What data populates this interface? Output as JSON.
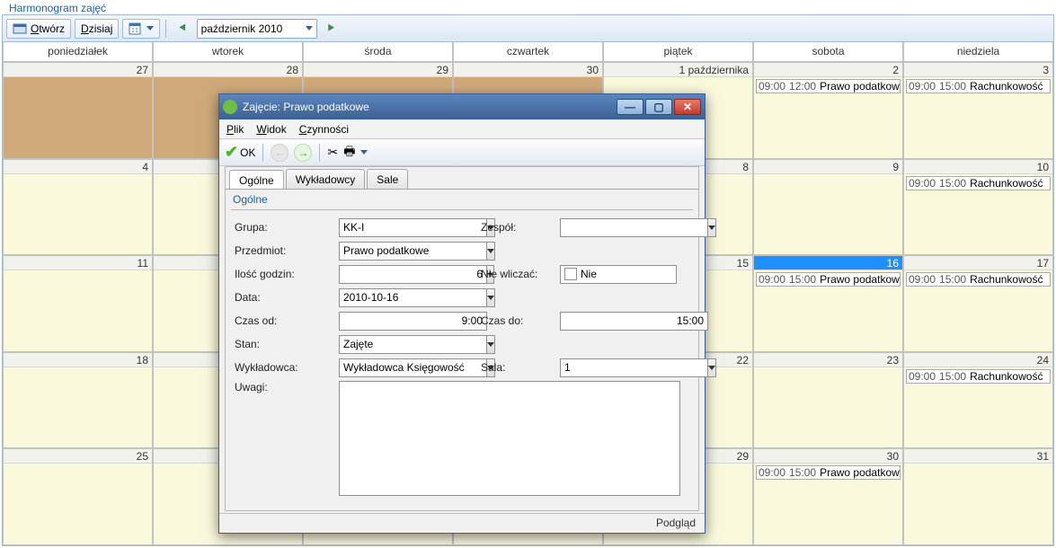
{
  "panel_title": "Harmonogram zajęć",
  "toolbar": {
    "open": "Otwórz",
    "today": "Dzisiaj",
    "month": "październik 2010"
  },
  "days": [
    "poniedziałek",
    "wtorek",
    "środa",
    "czwartek",
    "piątek",
    "sobota",
    "niedziela"
  ],
  "cells": [
    {
      "date": "27",
      "cls": "prev-month"
    },
    {
      "date": "28",
      "cls": "prev-month"
    },
    {
      "date": "29",
      "cls": "prev-month"
    },
    {
      "date": "30",
      "cls": "prev-month"
    },
    {
      "date": "1 października",
      "cls": "cur-month"
    },
    {
      "date": "2",
      "cls": "cur-month",
      "ev": [
        {
          "s": "09:00",
          "e": "12:00",
          "t": "Prawo podatkowe"
        }
      ]
    },
    {
      "date": "3",
      "cls": "cur-month",
      "ev": [
        {
          "s": "09:00",
          "e": "15:00",
          "t": "Rachunkowość"
        }
      ]
    },
    {
      "date": "4",
      "cls": "cur-month"
    },
    {
      "date": "",
      "cls": "cur-month"
    },
    {
      "date": "",
      "cls": "cur-month"
    },
    {
      "date": "",
      "cls": "cur-month"
    },
    {
      "date": "8",
      "cls": "cur-month"
    },
    {
      "date": "9",
      "cls": "cur-month"
    },
    {
      "date": "10",
      "cls": "cur-month",
      "ev": [
        {
          "s": "09:00",
          "e": "15:00",
          "t": "Rachunkowość"
        }
      ]
    },
    {
      "date": "11",
      "cls": "cur-month"
    },
    {
      "date": "",
      "cls": "cur-month"
    },
    {
      "date": "",
      "cls": "cur-month"
    },
    {
      "date": "",
      "cls": "cur-month"
    },
    {
      "date": "15",
      "cls": "cur-month"
    },
    {
      "date": "16",
      "cls": "cur-month",
      "sel": true,
      "ev": [
        {
          "s": "09:00",
          "e": "15:00",
          "t": "Prawo podatkowe"
        }
      ]
    },
    {
      "date": "17",
      "cls": "cur-month",
      "ev": [
        {
          "s": "09:00",
          "e": "15:00",
          "t": "Rachunkowość"
        }
      ]
    },
    {
      "date": "18",
      "cls": "cur-month"
    },
    {
      "date": "",
      "cls": "cur-month"
    },
    {
      "date": "",
      "cls": "cur-month"
    },
    {
      "date": "",
      "cls": "cur-month"
    },
    {
      "date": "22",
      "cls": "cur-month"
    },
    {
      "date": "23",
      "cls": "cur-month"
    },
    {
      "date": "24",
      "cls": "cur-month",
      "ev": [
        {
          "s": "09:00",
          "e": "15:00",
          "t": "Rachunkowość"
        }
      ]
    },
    {
      "date": "25",
      "cls": "cur-month"
    },
    {
      "date": "",
      "cls": "cur-month"
    },
    {
      "date": "",
      "cls": "cur-month"
    },
    {
      "date": "",
      "cls": "cur-month"
    },
    {
      "date": "29",
      "cls": "cur-month"
    },
    {
      "date": "30",
      "cls": "cur-month",
      "ev": [
        {
          "s": "09:00",
          "e": "15:00",
          "t": "Prawo podatkowe"
        }
      ]
    },
    {
      "date": "31",
      "cls": "cur-month"
    }
  ],
  "dlg": {
    "title": "Zajęcie: Prawo podatkowe",
    "menu": {
      "file": "Plik",
      "view": "Widok",
      "actions": "Czynności"
    },
    "ok": "OK",
    "tabs": {
      "general": "Ogólne",
      "lecturers": "Wykładowcy",
      "rooms": "Sale"
    },
    "section": "Ogólne",
    "labels": {
      "grupa": "Grupa:",
      "przedmiot": "Przedmiot:",
      "ilosc": "Ilość godzin:",
      "data": "Data:",
      "czas_od": "Czas od:",
      "stan": "Stan:",
      "wykladowca": "Wykładowca:",
      "uwagi": "Uwagi:",
      "zespol": "Zespół:",
      "nie_wliczac": "Nie wliczać:",
      "czas_do": "Czas do:",
      "sala": "Sala:"
    },
    "values": {
      "grupa": "KK-I",
      "przedmiot": "Prawo podatkowe",
      "ilosc": "6",
      "data": "2010-10-16",
      "czas_od": "9:00",
      "stan": "Zajęte",
      "wykladowca": "Wykładowca Księgowość",
      "uwagi": "",
      "zespol": "",
      "nie": "Nie",
      "czas_do": "15:00",
      "sala": "1"
    },
    "status": "Podgląd"
  }
}
